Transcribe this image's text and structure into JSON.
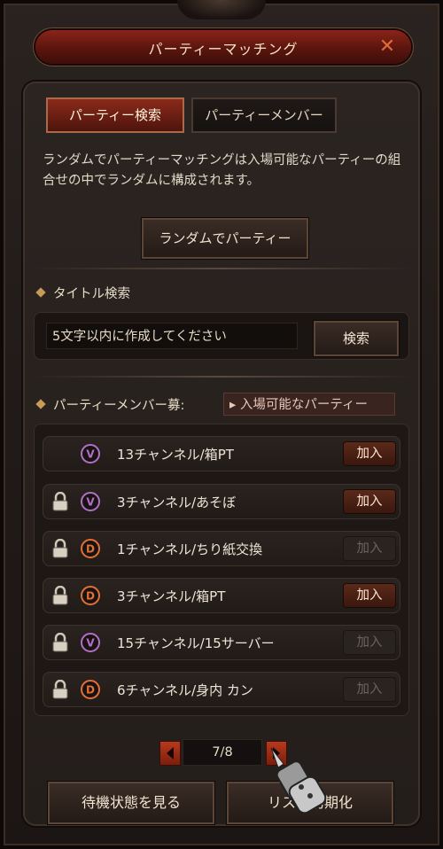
{
  "window": {
    "title": "パーティーマッチング"
  },
  "tabs": [
    {
      "label": "パーティー検索",
      "active": true
    },
    {
      "label": "パーティーメンバー",
      "active": false
    }
  ],
  "random": {
    "description": "ランダムでパーティーマッチングは入場可能なパーティーの組合せの中でランダムに構成されます。",
    "button_label": "ランダムでパーティー"
  },
  "title_search": {
    "section_label": "タイトル検索",
    "input_value": "5文字以内に作成してください",
    "button_label": "検索"
  },
  "recruit": {
    "section_label": "パーティーメンバー募:",
    "filter_label": "▸ 入場可能なパーティー"
  },
  "parties": [
    {
      "name": "13チャンネル/箱PT",
      "locked": false,
      "type_icon": "v-emblem-icon",
      "join_label": "加入",
      "join_enabled": true
    },
    {
      "name": "3チャンネル/あそぼ",
      "locked": true,
      "type_icon": "v-emblem-icon",
      "join_label": "加入",
      "join_enabled": true
    },
    {
      "name": "1チャンネル/ちり紙交換",
      "locked": true,
      "type_icon": "d-emblem-icon",
      "join_label": "加入",
      "join_enabled": false
    },
    {
      "name": "3チャンネル/箱PT",
      "locked": true,
      "type_icon": "d-emblem-icon",
      "join_label": "加入",
      "join_enabled": true
    },
    {
      "name": "15チャンネル/15サーバー",
      "locked": true,
      "type_icon": "v-emblem-icon",
      "join_label": "加入",
      "join_enabled": false
    },
    {
      "name": "6チャンネル/身内 カン",
      "locked": true,
      "type_icon": "d-emblem-icon",
      "join_label": "加入",
      "join_enabled": false
    }
  ],
  "pager": {
    "current": 7,
    "total": 8,
    "display": "7/8"
  },
  "footer": {
    "wait_label": "待機状態を見る",
    "reset_label": "リスト初期化"
  },
  "colors": {
    "accent_red": "#8a2418",
    "v_emblem": "#b070c8",
    "d_emblem": "#e07038",
    "text": "#e8e0d4"
  }
}
